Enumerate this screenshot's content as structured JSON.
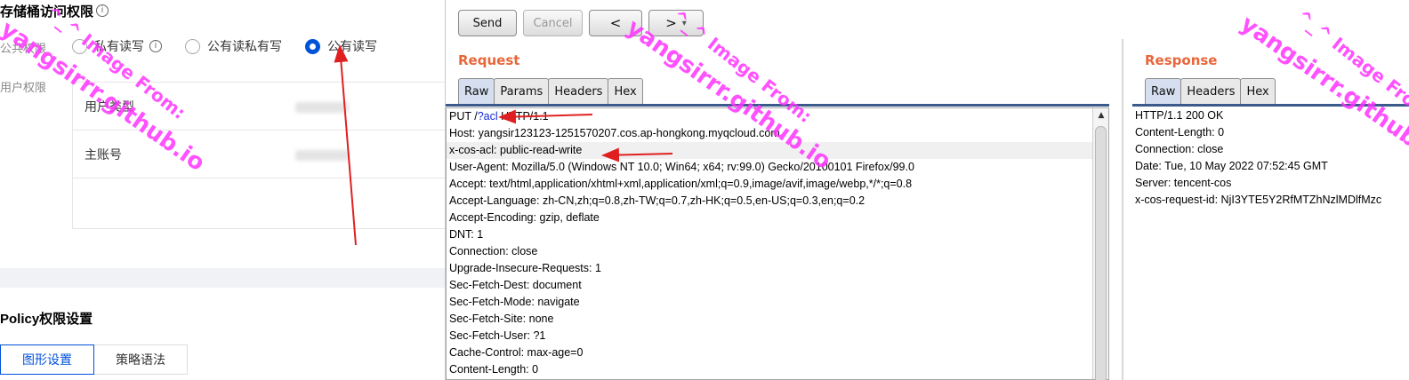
{
  "console": {
    "section_title": "存储桶访问权限",
    "public_perm_label": "公共权限",
    "user_perm_label": "用户权限",
    "radio_options": [
      {
        "label": "私有读写",
        "selected": false,
        "has_info": true
      },
      {
        "label": "公有读私有写",
        "selected": false,
        "has_info": false
      },
      {
        "label": "公有读写",
        "selected": true,
        "has_info": false
      }
    ],
    "user_table_rows": [
      "用户类型",
      "主账号",
      ""
    ],
    "policy_title": "Policy权限设置",
    "policy_tabs": [
      {
        "label": "图形设置",
        "active": true
      },
      {
        "label": "策略语法",
        "active": false
      }
    ],
    "accent_color": "#0052d9"
  },
  "burp": {
    "buttons": {
      "send": "Send",
      "cancel": "Cancel",
      "back": "<",
      "forward": ">",
      "dropdown": "▾"
    },
    "request": {
      "title": "Request",
      "tabs": [
        "Raw",
        "Params",
        "Headers",
        "Hex"
      ],
      "active_tab": "Raw",
      "lines": [
        {
          "pre": "PUT  /",
          "hl_text": "?acl",
          "post": " HTTP/1.1"
        },
        {
          "pre": "Host: yangsir123123-1251570207.cos.ap-hongkong.myqcloud.com"
        },
        {
          "pre": "x-cos-acl: public-read-write",
          "highlighted": true
        },
        {
          "pre": "User-Agent: Mozilla/5.0 (Windows NT 10.0; Win64; x64; rv:99.0) Gecko/20100101 Firefox/99.0"
        },
        {
          "pre": "Accept: text/html,application/xhtml+xml,application/xml;q=0.9,image/avif,image/webp,*/*;q=0.8"
        },
        {
          "pre": "Accept-Language: zh-CN,zh;q=0.8,zh-TW;q=0.7,zh-HK;q=0.5,en-US;q=0.3,en;q=0.2"
        },
        {
          "pre": "Accept-Encoding: gzip, deflate"
        },
        {
          "pre": "DNT: 1"
        },
        {
          "pre": "Connection: close"
        },
        {
          "pre": "Upgrade-Insecure-Requests: 1"
        },
        {
          "pre": "Sec-Fetch-Dest: document"
        },
        {
          "pre": "Sec-Fetch-Mode: navigate"
        },
        {
          "pre": "Sec-Fetch-Site: none"
        },
        {
          "pre": "Sec-Fetch-User: ?1"
        },
        {
          "pre": "Cache-Control: max-age=0"
        },
        {
          "pre": "Content-Length: 0"
        }
      ]
    },
    "response": {
      "title": "Response",
      "tabs": [
        "Raw",
        "Headers",
        "Hex"
      ],
      "active_tab": "Raw",
      "lines": [
        "HTTP/1.1 200 OK",
        "Content-Length: 0",
        "Connection: close",
        "Date: Tue, 10 May 2022 07:52:45 GMT",
        "Server: tencent-cos",
        "x-cos-request-id: NjI3YTE5Y2RfMTZhNzlMDlfMzc"
      ]
    },
    "title_color": "#e8673a"
  },
  "watermarks": [
    "yangsirrr.github.io",
    "^_^ Image From:"
  ],
  "watermark_color": "#ff33ff",
  "arrow_color": "#e02020"
}
